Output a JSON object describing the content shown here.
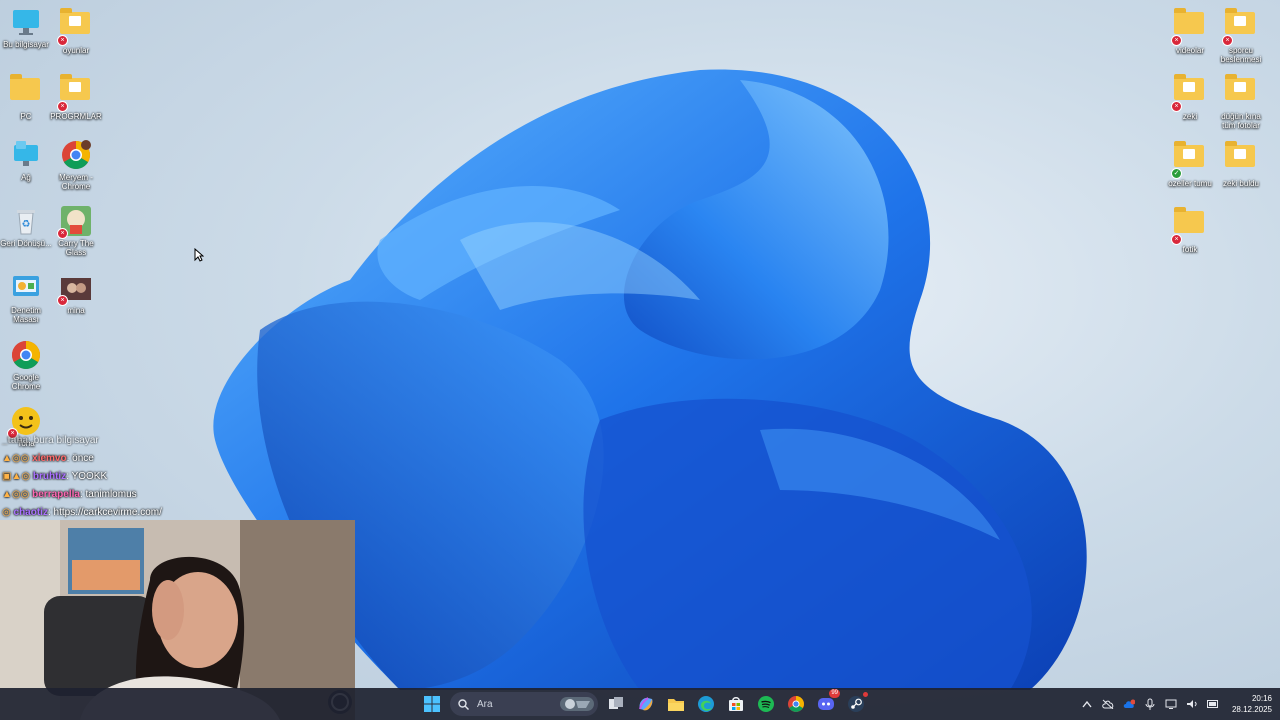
{
  "desktop": {
    "icons_left_col1": [
      {
        "label": "Bu bilgisayar",
        "icon": "monitor-icon"
      },
      {
        "label": "PC",
        "icon": "folder-icon"
      },
      {
        "label": "Ağ",
        "icon": "network-icon"
      },
      {
        "label": "Geri Dönüşü...",
        "icon": "recycle-bin-icon"
      },
      {
        "label": "Denetim Masası",
        "icon": "control-panel-icon"
      },
      {
        "label": "Google Chrome",
        "icon": "chrome-icon"
      },
      {
        "label": "Tona",
        "icon": "app-icon"
      }
    ],
    "icons_left_col2": [
      {
        "label": "oyunlar",
        "icon": "folder-icon"
      },
      {
        "label": "PROGRMLAR",
        "icon": "folder-icon"
      },
      {
        "label": "Meryem - Chrome",
        "icon": "chrome-icon"
      },
      {
        "label": "Carry The Glass",
        "icon": "game-icon"
      },
      {
        "label": "mina",
        "icon": "image-icon"
      }
    ],
    "icons_right_col1": [
      {
        "label": "videolar",
        "icon": "folder-icon"
      },
      {
        "label": "zeki",
        "icon": "folder-icon"
      },
      {
        "label": "ozeller tumu",
        "icon": "folder-icon"
      },
      {
        "label": "fotik",
        "icon": "folder-icon"
      }
    ],
    "icons_right_col2": [
      {
        "label": "sporcu beslenmesi",
        "icon": "folder-icon"
      },
      {
        "label": "düğün kına tüm fotolar",
        "icon": "folder-icon"
      },
      {
        "label": "zeki buldu",
        "icon": "folder-icon"
      }
    ]
  },
  "chat": {
    "messages": [
      {
        "user": "_taha",
        "text": ": bura bilgisayar",
        "color": "#bbbbbb"
      },
      {
        "user": "xiemvo",
        "text": ": önce",
        "color": "#ff6b6b"
      },
      {
        "user": "bruhtiz",
        "text": ": YOOKK",
        "color": "#a970ff"
      },
      {
        "user": "berrapella",
        "text": ": tanimlomus",
        "color": "#ff69b4"
      },
      {
        "user": "chaotiz",
        "text": ": https://carkcevirme.com/",
        "color": "#a970ff"
      }
    ]
  },
  "taskbar": {
    "search_placeholder": "Ara",
    "apps": [
      "windows-start-icon",
      "task-view-icon",
      "copilot-icon",
      "file-explorer-icon",
      "edge-icon",
      "store-icon",
      "spotify-icon",
      "chrome-icon",
      "discord-icon",
      "steam-icon"
    ],
    "discord_badge": "99",
    "time": "20:16",
    "date": "28.12.2025"
  },
  "colors": {
    "taskbar_bg": "#1e2230",
    "bloom_blue": "#1e6ce0",
    "folder": "#f6c84e"
  }
}
